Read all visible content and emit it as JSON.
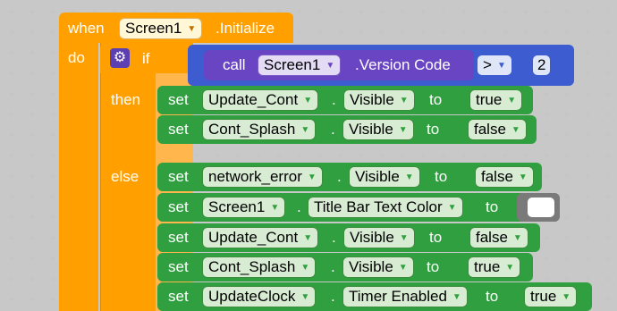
{
  "event": {
    "when_label": "when",
    "component": "Screen1",
    "event_name": ".Initialize",
    "do_label": "do"
  },
  "if_block": {
    "if_label": "if",
    "then_label": "then",
    "else_label": "else"
  },
  "condition": {
    "call_label": "call",
    "component": "Screen1",
    "method": ".Version Code",
    "operator": ">",
    "value": "2"
  },
  "then_statements": [
    {
      "set": "set",
      "component": "Update_Cont",
      "dot": ".",
      "property": "Visible",
      "to": "to",
      "value": "true"
    },
    {
      "set": "set",
      "component": "Cont_Splash",
      "dot": ".",
      "property": "Visible",
      "to": "to",
      "value": "false"
    }
  ],
  "else_statements": [
    {
      "set": "set",
      "component": "network_error",
      "dot": ".",
      "property": "Visible",
      "to": "to",
      "value": "false"
    },
    {
      "set": "set",
      "component": "Screen1",
      "dot": ".",
      "property": "Title Bar Text Color",
      "to": "to",
      "value": "color-white"
    },
    {
      "set": "set",
      "component": "Update_Cont",
      "dot": ".",
      "property": "Visible",
      "to": "to",
      "value": "false"
    },
    {
      "set": "set",
      "component": "Cont_Splash",
      "dot": ".",
      "property": "Visible",
      "to": "to",
      "value": "true"
    },
    {
      "set": "set",
      "component": "UpdateClock",
      "dot": ".",
      "property": "Timer Enabled",
      "to": "to",
      "value": "true"
    }
  ],
  "colors": {
    "event_block": "#ffa000",
    "set_block": "#2f9f3f",
    "call_block": "#6a45c3",
    "math_block": "#3c5ccf",
    "color_swatch": "#ffffff"
  }
}
